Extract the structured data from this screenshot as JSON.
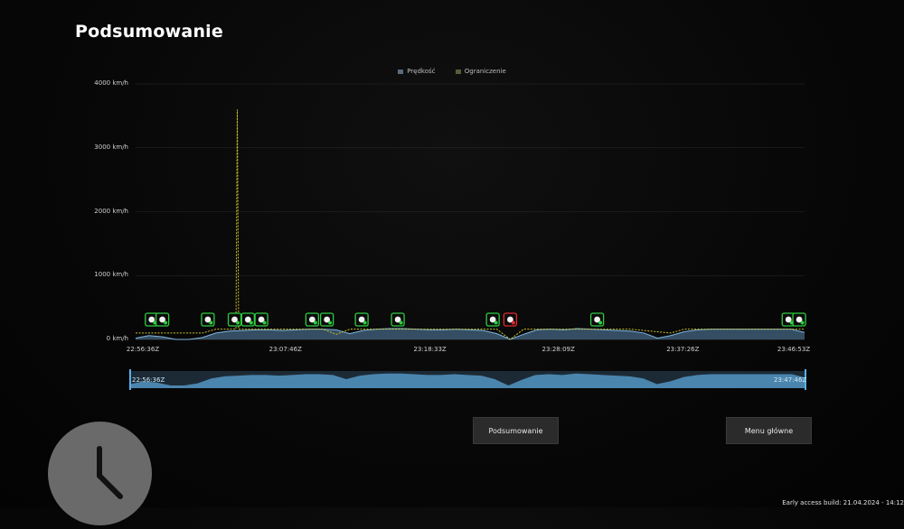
{
  "page": {
    "title": "Podsumowanie"
  },
  "legend": [
    {
      "label": "Prędkość",
      "color": "#5a6a7a"
    },
    {
      "label": "Ograniczenie",
      "color": "#5a5a3a"
    }
  ],
  "chart_data": {
    "type": "area",
    "title": "",
    "xlabel": "",
    "ylabel": "",
    "y_unit": "km/h",
    "ylim": [
      0,
      4000
    ],
    "y_ticks": [
      "0 km/h",
      "1000 km/h",
      "2000 km/h",
      "3000 km/h",
      "4000 km/h"
    ],
    "x_ticks": [
      "22:56:36Z",
      "23:07:46Z",
      "23:18:33Z",
      "23:28:09Z",
      "23:37:26Z",
      "23:46:53Z"
    ],
    "grid": true,
    "legend_position": "top-center",
    "series": [
      {
        "name": "Prędkość",
        "x_minutes_from_start": [
          0,
          1,
          2,
          3,
          4,
          5,
          6,
          7,
          8,
          9,
          10,
          11,
          12,
          13,
          14,
          15,
          16,
          17,
          18,
          19,
          20,
          21,
          22,
          23,
          24,
          25,
          26,
          27,
          28,
          29,
          30,
          31,
          32,
          33,
          34,
          35,
          36,
          37,
          38,
          39,
          40,
          41,
          42,
          43,
          44,
          45,
          46,
          47,
          48,
          49,
          50
        ],
        "values": [
          20,
          60,
          40,
          0,
          0,
          30,
          100,
          130,
          140,
          150,
          150,
          140,
          150,
          160,
          160,
          150,
          90,
          140,
          160,
          170,
          170,
          160,
          150,
          150,
          160,
          150,
          140,
          90,
          0,
          80,
          150,
          160,
          150,
          170,
          160,
          150,
          140,
          130,
          100,
          20,
          60,
          120,
          150,
          160,
          160,
          160,
          160,
          160,
          160,
          160,
          110
        ]
      },
      {
        "name": "Ograniczenie",
        "x_minutes_from_start": [
          0,
          5,
          6,
          7.5,
          7.6,
          7.7,
          8,
          14,
          15,
          16,
          27,
          28,
          29,
          30,
          36,
          37,
          40,
          41,
          49,
          50
        ],
        "values": [
          100,
          100,
          160,
          160,
          3600,
          160,
          160,
          160,
          80,
          160,
          160,
          0,
          160,
          160,
          160,
          160,
          100,
          160,
          160,
          160
        ]
      }
    ]
  },
  "markers": [
    {
      "x_minutes_from_start": 1.2,
      "icon": "traffic-light-icon",
      "status": "ok"
    },
    {
      "x_minutes_from_start": 2.0,
      "icon": "hand-stop-icon",
      "status": "ok"
    },
    {
      "x_minutes_from_start": 5.4,
      "icon": "speed-shield-icon",
      "status": "ok"
    },
    {
      "x_minutes_from_start": 7.4,
      "icon": "speed-shield-icon",
      "status": "ok"
    },
    {
      "x_minutes_from_start": 8.4,
      "icon": "speed-shield-icon",
      "status": "ok"
    },
    {
      "x_minutes_from_start": 9.4,
      "icon": "horn-icon",
      "status": "ok"
    },
    {
      "x_minutes_from_start": 13.2,
      "icon": "speed-shield-icon",
      "status": "ok"
    },
    {
      "x_minutes_from_start": 14.3,
      "icon": "traffic-light-icon",
      "status": "ok"
    },
    {
      "x_minutes_from_start": 16.9,
      "icon": "speed-shield-icon",
      "status": "ok"
    },
    {
      "x_minutes_from_start": 19.6,
      "icon": "speed-shield-icon",
      "status": "ok"
    },
    {
      "x_minutes_from_start": 26.7,
      "icon": "speed-shield-icon",
      "status": "ok"
    },
    {
      "x_minutes_from_start": 28.0,
      "icon": "stop-sign-icon",
      "status": "fail"
    },
    {
      "x_minutes_from_start": 34.5,
      "icon": "speed-shield-icon",
      "status": "ok"
    },
    {
      "x_minutes_from_start": 48.8,
      "icon": "speed-shield-icon",
      "status": "ok"
    },
    {
      "x_minutes_from_start": 49.6,
      "icon": "horn-icon",
      "status": "ok"
    }
  ],
  "navigator": {
    "start_label": "22:56:36Z",
    "end_label": "23:47:46Z"
  },
  "buttons": {
    "summary": "Podsumowanie",
    "main_menu": "Menu główne"
  },
  "footer": {
    "build": "Early access build: 21.04.2024 - 14:12"
  },
  "colors": {
    "speed_fill": "#3d5a73",
    "speed_line": "#7fb7e0",
    "limit_line": "#c9c22a",
    "marker_ok": "#2ecc40",
    "marker_fail": "#e0282c",
    "grid": "#2a2a2a"
  }
}
